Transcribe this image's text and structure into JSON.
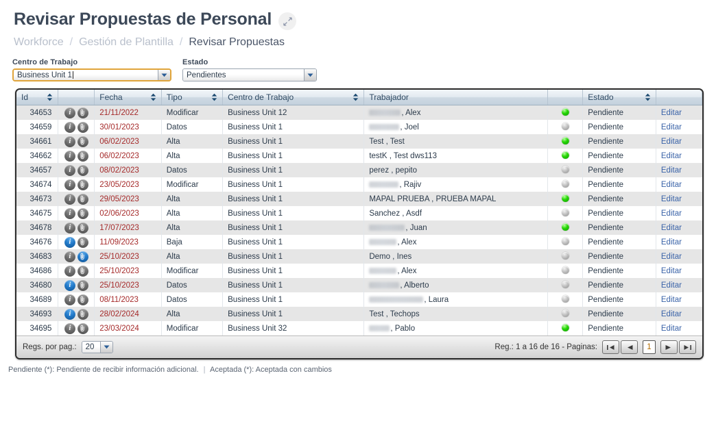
{
  "header": {
    "title": "Revisar Propuestas de Personal",
    "expand_icon": "expand-arrows-icon",
    "breadcrumb": [
      "Workforce",
      "Gestión de Plantilla",
      "Revisar Propuestas"
    ],
    "breadcrumb_separator": "/"
  },
  "filters": [
    {
      "label": "Centro de Trabajo",
      "value": "Business Unit 1",
      "focused": true
    },
    {
      "label": "Estado",
      "value": "Pendientes",
      "focused": false
    }
  ],
  "table": {
    "columns": [
      {
        "label": "Id",
        "sortable": true
      },
      {
        "label": "",
        "sortable": false
      },
      {
        "label": "Fecha",
        "sortable": true
      },
      {
        "label": "Tipo",
        "sortable": true
      },
      {
        "label": "Centro de Trabajo",
        "sortable": true
      },
      {
        "label": "Trabajador",
        "sortable": false
      },
      {
        "label": "",
        "sortable": false
      },
      {
        "label": "Estado",
        "sortable": true
      },
      {
        "label": "",
        "sortable": false
      }
    ],
    "action_label": "Editar",
    "rows": [
      {
        "id": "34653",
        "info_blue": false,
        "clip_blue": false,
        "fecha": "21/11/2022",
        "tipo": "Modificar",
        "centro": "Business Unit 12",
        "trabajador_redacted": 46,
        "trabajador": ", Alex",
        "dot": "green",
        "estado": "Pendiente"
      },
      {
        "id": "34659",
        "info_blue": false,
        "clip_blue": false,
        "fecha": "30/01/2023",
        "tipo": "Datos",
        "centro": "Business Unit 1",
        "trabajador_redacted": 44,
        "trabajador": ", Joel",
        "dot": "gray",
        "estado": "Pendiente"
      },
      {
        "id": "34661",
        "info_blue": false,
        "clip_blue": false,
        "fecha": "06/02/2023",
        "tipo": "Alta",
        "centro": "Business Unit 1",
        "trabajador_redacted": 0,
        "trabajador": "Test , Test",
        "dot": "green",
        "estado": "Pendiente"
      },
      {
        "id": "34662",
        "info_blue": false,
        "clip_blue": false,
        "fecha": "06/02/2023",
        "tipo": "Alta",
        "centro": "Business Unit 1",
        "trabajador_redacted": 0,
        "trabajador": "testK , Test dws113",
        "dot": "green",
        "estado": "Pendiente"
      },
      {
        "id": "34657",
        "info_blue": false,
        "clip_blue": false,
        "fecha": "08/02/2023",
        "tipo": "Datos",
        "centro": "Business Unit 1",
        "trabajador_redacted": 0,
        "trabajador": "perez , pepito",
        "dot": "gray",
        "estado": "Pendiente"
      },
      {
        "id": "34674",
        "info_blue": false,
        "clip_blue": false,
        "fecha": "23/05/2023",
        "tipo": "Modificar",
        "centro": "Business Unit 1",
        "trabajador_redacted": 43,
        "trabajador": ", Rajiv",
        "dot": "gray",
        "estado": "Pendiente"
      },
      {
        "id": "34673",
        "info_blue": false,
        "clip_blue": false,
        "fecha": "29/05/2023",
        "tipo": "Alta",
        "centro": "Business Unit 1",
        "trabajador_redacted": 0,
        "trabajador": "MAPAL PRUEBA , PRUEBA MAPAL",
        "dot": "green",
        "estado": "Pendiente"
      },
      {
        "id": "34675",
        "info_blue": false,
        "clip_blue": false,
        "fecha": "02/06/2023",
        "tipo": "Alta",
        "centro": "Business Unit 1",
        "trabajador_redacted": 0,
        "trabajador": "Sanchez , Asdf",
        "dot": "gray",
        "estado": "Pendiente"
      },
      {
        "id": "34678",
        "info_blue": false,
        "clip_blue": false,
        "fecha": "17/07/2023",
        "tipo": "Alta",
        "centro": "Business Unit 1",
        "trabajador_redacted": 52,
        "trabajador": ", Juan",
        "dot": "green",
        "estado": "Pendiente"
      },
      {
        "id": "34676",
        "info_blue": true,
        "clip_blue": false,
        "fecha": "11/09/2023",
        "tipo": "Baja",
        "centro": "Business Unit 1",
        "trabajador_redacted": 40,
        "trabajador": ", Alex",
        "dot": "gray",
        "estado": "Pendiente"
      },
      {
        "id": "34683",
        "info_blue": false,
        "clip_blue": true,
        "fecha": "25/10/2023",
        "tipo": "Alta",
        "centro": "Business Unit 1",
        "trabajador_redacted": 0,
        "trabajador": "Demo , Ines",
        "dot": "gray",
        "estado": "Pendiente"
      },
      {
        "id": "34686",
        "info_blue": false,
        "clip_blue": false,
        "fecha": "25/10/2023",
        "tipo": "Modificar",
        "centro": "Business Unit 1",
        "trabajador_redacted": 40,
        "trabajador": ", Alex",
        "dot": "gray",
        "estado": "Pendiente"
      },
      {
        "id": "34680",
        "info_blue": true,
        "clip_blue": false,
        "fecha": "25/10/2023",
        "tipo": "Datos",
        "centro": "Business Unit 1",
        "trabajador_redacted": 44,
        "trabajador": ", Alberto",
        "dot": "gray",
        "estado": "Pendiente"
      },
      {
        "id": "34689",
        "info_blue": false,
        "clip_blue": false,
        "fecha": "08/11/2023",
        "tipo": "Datos",
        "centro": "Business Unit 1",
        "trabajador_redacted": 79,
        "trabajador": ", Laura",
        "dot": "gray",
        "estado": "Pendiente"
      },
      {
        "id": "34693",
        "info_blue": true,
        "clip_blue": false,
        "fecha": "28/02/2024",
        "tipo": "Alta",
        "centro": "Business Unit 1",
        "trabajador_redacted": 0,
        "trabajador": "Test , Techops",
        "dot": "gray",
        "estado": "Pendiente"
      },
      {
        "id": "34695",
        "info_blue": false,
        "clip_blue": false,
        "fecha": "23/03/2024",
        "tipo": "Modificar",
        "centro": "Business Unit 32",
        "trabajador_redacted": 30,
        "trabajador": ", Pablo",
        "dot": "green",
        "estado": "Pendiente"
      }
    ]
  },
  "footer": {
    "per_page_label": "Regs. por pag.:",
    "per_page_value": "20",
    "records_label": "Reg.: 1 a 16 de 16 - Paginas:",
    "page_value": "1",
    "buttons": [
      "first-page",
      "prev-page",
      "next-page",
      "last-page"
    ]
  },
  "legend": {
    "part1": "Pendiente (*): Pendiente de recibir información adicional.",
    "divider": "|",
    "part2": "Aceptada (*): Aceptada con cambios"
  }
}
